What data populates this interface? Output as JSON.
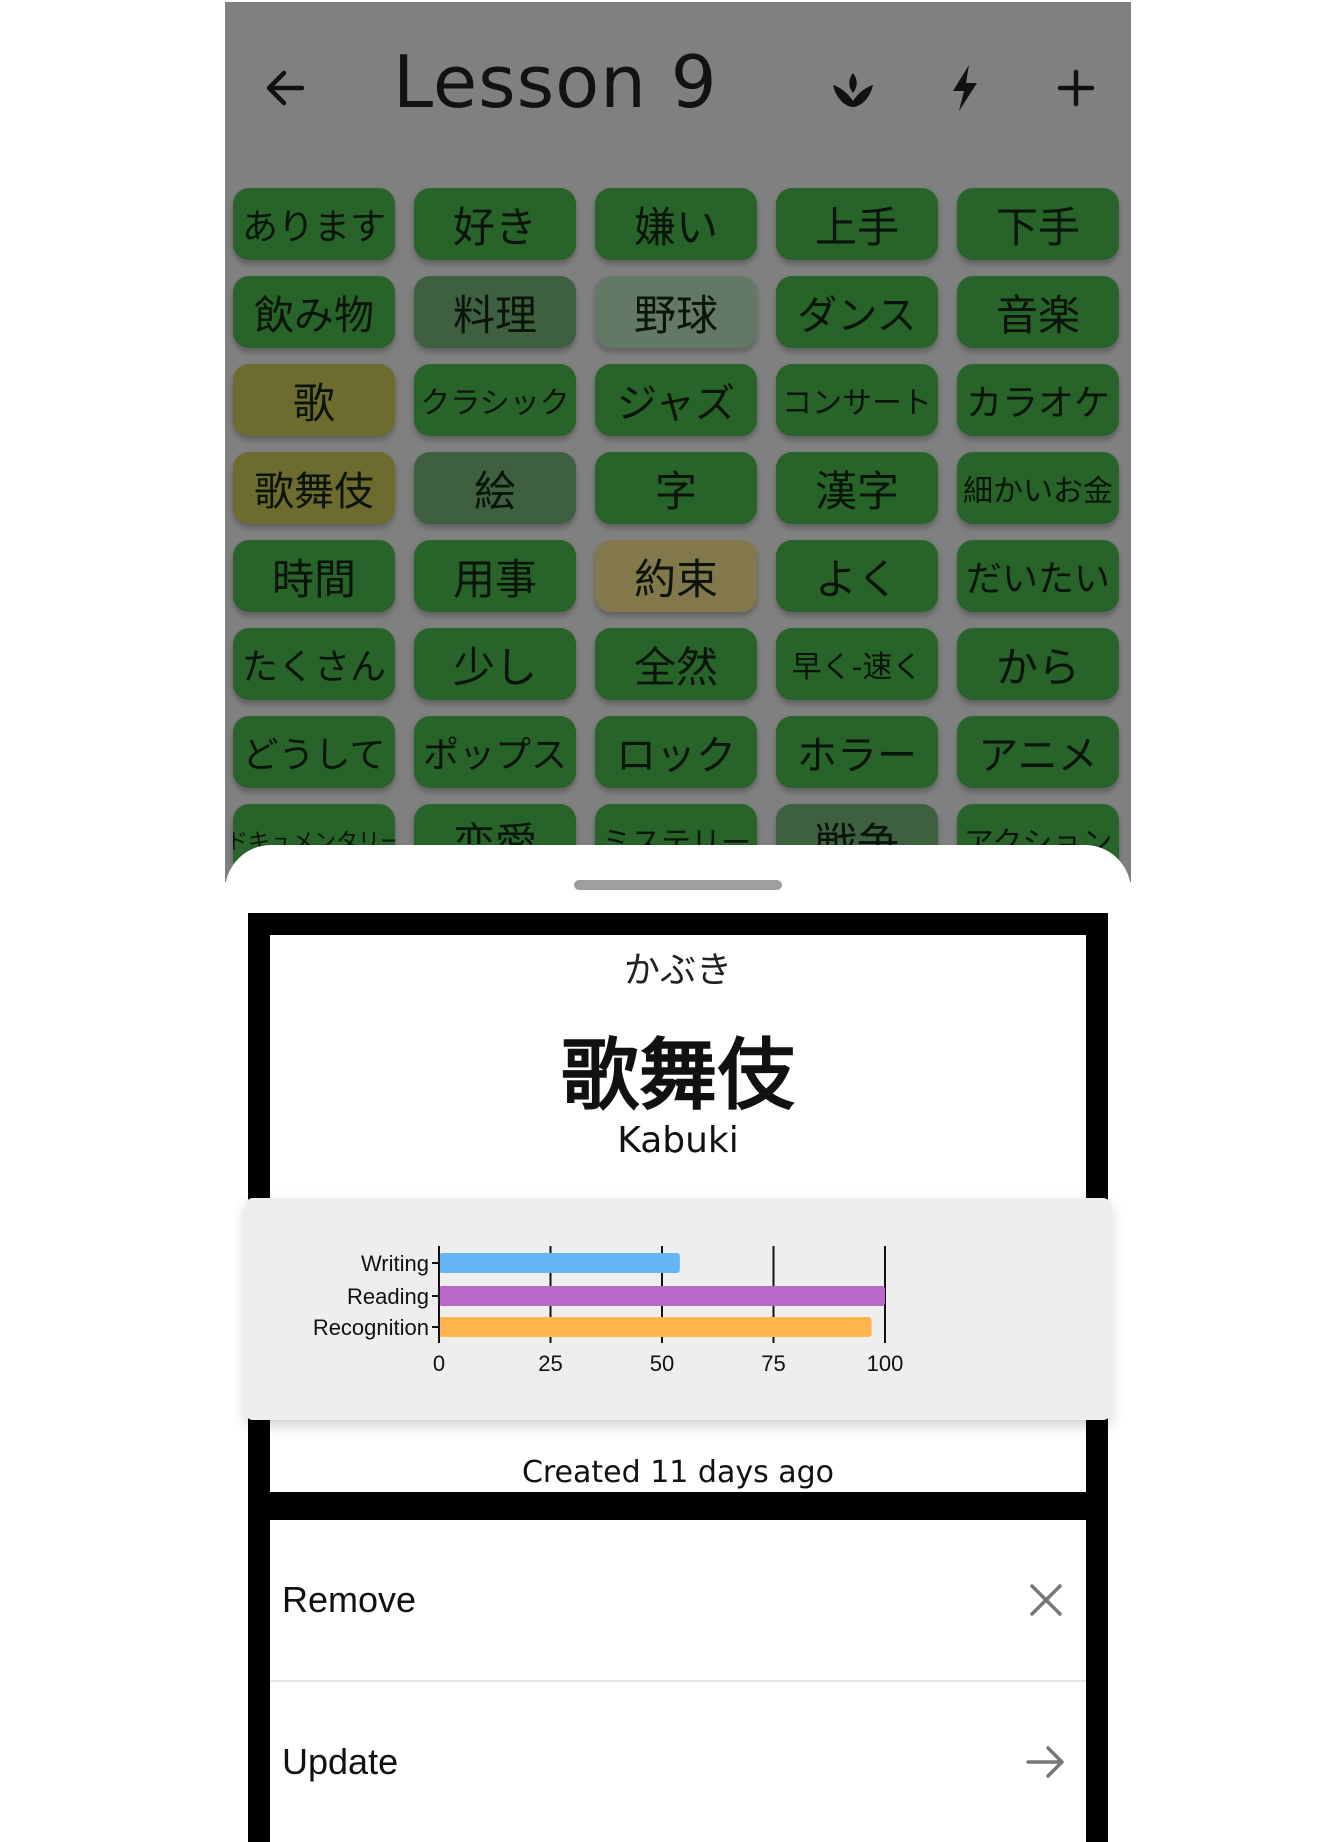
{
  "app_bar": {
    "title": "Lesson 9",
    "back_icon": "arrow-left-icon",
    "actions": [
      "sprout-icon",
      "lightning-icon",
      "plus-icon"
    ]
  },
  "grid": {
    "rows": [
      [
        {
          "text": "あります",
          "status": "green"
        },
        {
          "text": "好き",
          "status": "green"
        },
        {
          "text": "嫌い",
          "status": "green"
        },
        {
          "text": "上手",
          "status": "green"
        },
        {
          "text": "下手",
          "status": "green"
        }
      ],
      [
        {
          "text": "飲み物",
          "status": "green"
        },
        {
          "text": "料理",
          "status": "faded"
        },
        {
          "text": "野球",
          "status": "pale"
        },
        {
          "text": "ダンス",
          "status": "green"
        },
        {
          "text": "音楽",
          "status": "green"
        }
      ],
      [
        {
          "text": "歌",
          "status": "yellow"
        },
        {
          "text": "クラシック",
          "status": "green"
        },
        {
          "text": "ジャズ",
          "status": "green"
        },
        {
          "text": "コンサート",
          "status": "green"
        },
        {
          "text": "カラオケ",
          "status": "green"
        }
      ],
      [
        {
          "text": "歌舞伎",
          "status": "yellow"
        },
        {
          "text": "絵",
          "status": "faded"
        },
        {
          "text": "字",
          "status": "green"
        },
        {
          "text": "漢字",
          "status": "green"
        },
        {
          "text": "細かいお金",
          "status": "green"
        }
      ],
      [
        {
          "text": "時間",
          "status": "green"
        },
        {
          "text": "用事",
          "status": "green"
        },
        {
          "text": "約束",
          "status": "tan"
        },
        {
          "text": "よく",
          "status": "green"
        },
        {
          "text": "だいたい",
          "status": "green"
        }
      ],
      [
        {
          "text": "たくさん",
          "status": "green"
        },
        {
          "text": "少し",
          "status": "green"
        },
        {
          "text": "全然",
          "status": "green"
        },
        {
          "text": "早く-速く",
          "status": "green"
        },
        {
          "text": "から",
          "status": "green"
        }
      ],
      [
        {
          "text": "どうして",
          "status": "green"
        },
        {
          "text": "ポップス",
          "status": "green"
        },
        {
          "text": "ロック",
          "status": "green"
        },
        {
          "text": "ホラー",
          "status": "green"
        },
        {
          "text": "アニメ",
          "status": "green"
        }
      ],
      [
        {
          "text": "ドキュメンタリー",
          "status": "green"
        },
        {
          "text": "恋愛",
          "status": "green"
        },
        {
          "text": "ミステリー",
          "status": "green"
        },
        {
          "text": "戦争",
          "status": "faded"
        },
        {
          "text": "アクション",
          "status": "green"
        }
      ]
    ]
  },
  "colors": {
    "green": "#28632a",
    "faded": "#3e5f40",
    "pale": "#647867",
    "yellow": "#6e6b2e",
    "tan": "#82784c",
    "writing": "#64b5f6",
    "reading": "#ba68c8",
    "recognition": "#ffb74d"
  },
  "detail": {
    "reading": "かぶき",
    "word": "歌舞伎",
    "meaning": "Kabuki",
    "created": "Created 11 days ago"
  },
  "chart_data": {
    "type": "bar",
    "orientation": "horizontal",
    "categories": [
      "Writing",
      "Reading",
      "Recognition"
    ],
    "values": [
      54,
      100,
      97
    ],
    "xlim": [
      0,
      100
    ],
    "xticks": [
      "0",
      "25",
      "50",
      "75",
      "100"
    ],
    "grid": "vertical"
  },
  "actions": {
    "remove_label": "Remove",
    "remove_icon": "close-icon",
    "update_label": "Update",
    "update_icon": "arrow-right-icon"
  }
}
